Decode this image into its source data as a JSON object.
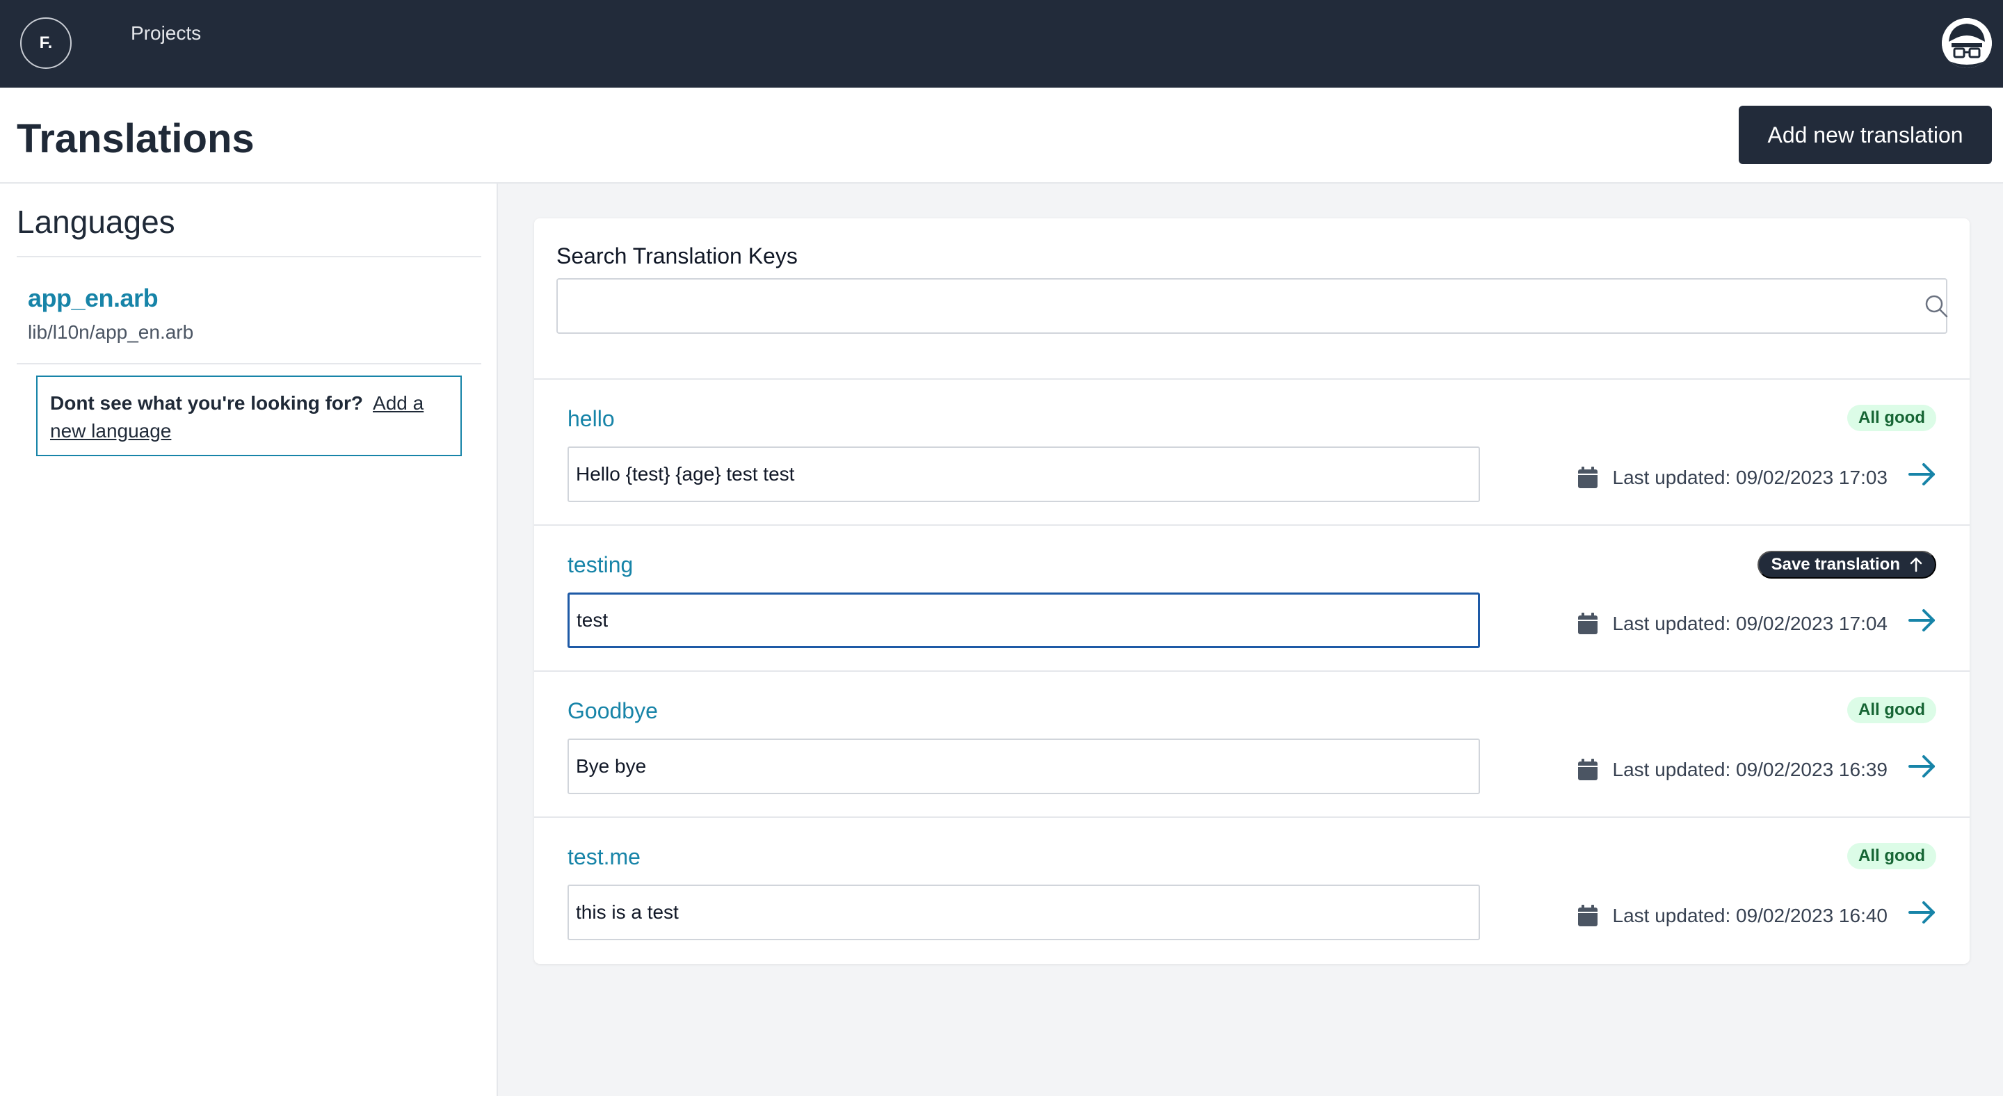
{
  "topbar": {
    "logo_text": "F.",
    "nav_projects": "Projects"
  },
  "header": {
    "title": "Translations",
    "add_button": "Add new translation"
  },
  "sidebar": {
    "title": "Languages",
    "language": {
      "name": "app_en.arb",
      "path": "lib/l10n/app_en.arb"
    },
    "help_text": "Dont see what you're looking for?",
    "help_link": "Add a new language"
  },
  "search": {
    "label": "Search Translation Keys",
    "value": "",
    "placeholder": ""
  },
  "rows": [
    {
      "key": "hello",
      "value": "Hello {test} {age} test test",
      "status": "All good",
      "updated": "Last updated: 09/02/2023 17:03"
    },
    {
      "key": "testing",
      "value": "test",
      "status": "Save translation",
      "updated": "Last updated: 09/02/2023 17:04"
    },
    {
      "key": "Goodbye",
      "value": "Bye bye",
      "status": "All good",
      "updated": "Last updated: 09/02/2023 16:39"
    },
    {
      "key": "test.me",
      "value": "this is a test",
      "status": "All good",
      "updated": "Last updated: 09/02/2023 16:40"
    }
  ],
  "colors": {
    "navbar": "#222b3a",
    "accent": "#1784a8",
    "success_bg": "#dcfce7",
    "success_text": "#166534",
    "focus": "#1e5aa6"
  },
  "icons": [
    "search-icon",
    "calendar-icon",
    "arrow-right-icon",
    "arrow-up-icon"
  ]
}
